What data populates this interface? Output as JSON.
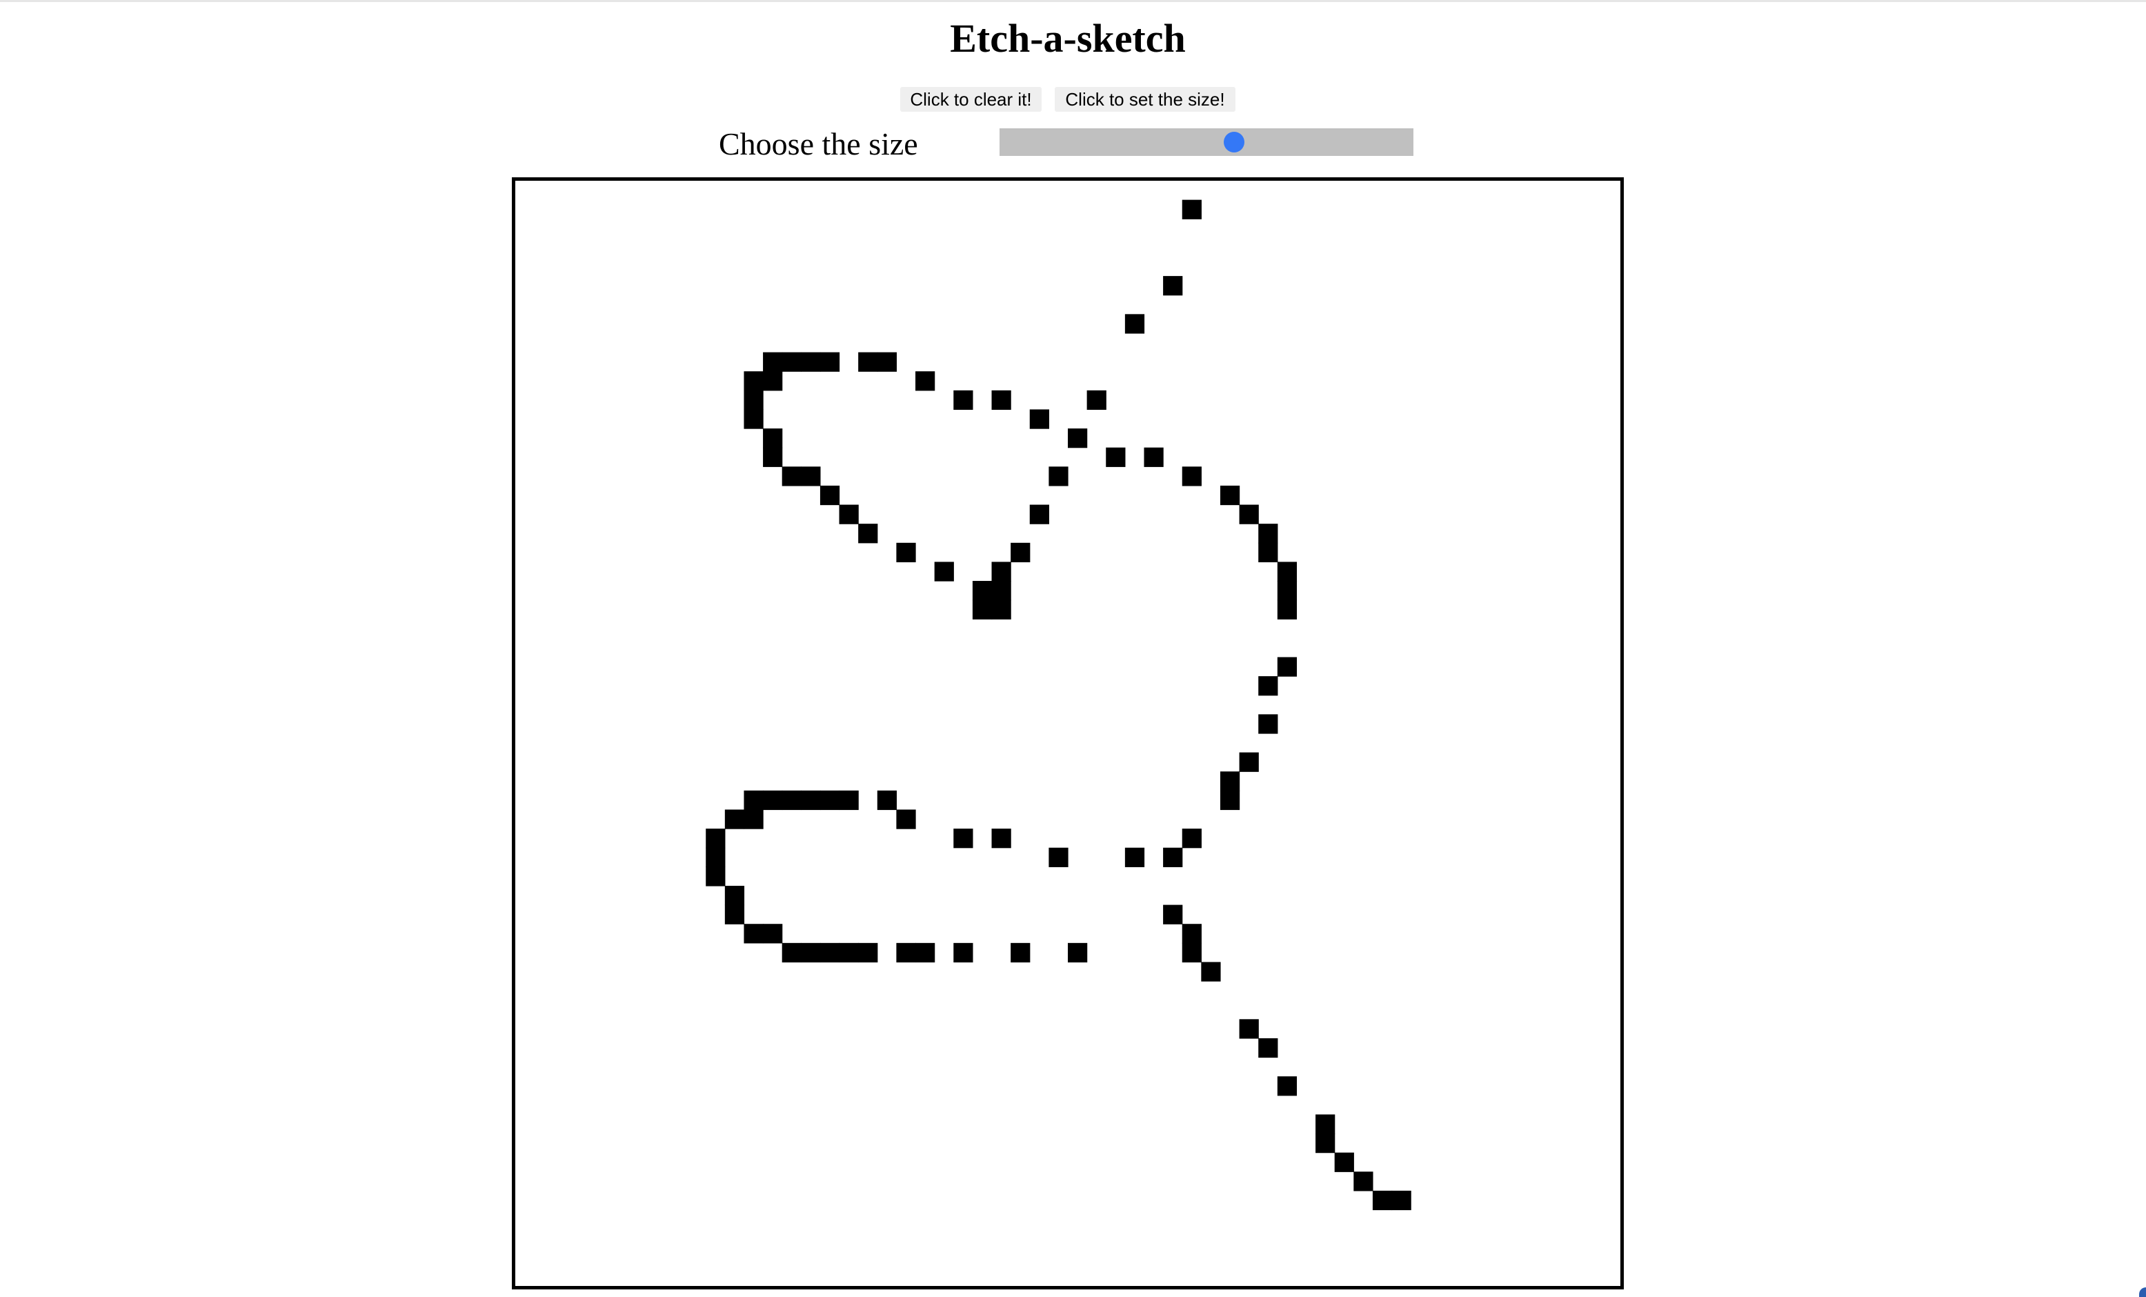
{
  "app": {
    "title": "Etch-a-sketch"
  },
  "controls": {
    "clear_label": "Click to clear it!",
    "set_size_label": "Click to set the size!",
    "size_label": "Choose the size",
    "slider": {
      "fraction": 0.57
    }
  },
  "sketch": {
    "ink_color": "#000000",
    "board_color": "#ffffff",
    "columns": 58,
    "filled_cells": [
      [
        35,
        1
      ],
      [
        34,
        5
      ],
      [
        32,
        7
      ],
      [
        13,
        9
      ],
      [
        14,
        9
      ],
      [
        15,
        9
      ],
      [
        16,
        9
      ],
      [
        18,
        9
      ],
      [
        19,
        9
      ],
      [
        12,
        10
      ],
      [
        13,
        10
      ],
      [
        21,
        10
      ],
      [
        12,
        11
      ],
      [
        23,
        11
      ],
      [
        25,
        11
      ],
      [
        30,
        11
      ],
      [
        12,
        12
      ],
      [
        27,
        12
      ],
      [
        13,
        13
      ],
      [
        29,
        13
      ],
      [
        13,
        14
      ],
      [
        31,
        14
      ],
      [
        33,
        14
      ],
      [
        14,
        15
      ],
      [
        15,
        15
      ],
      [
        28,
        15
      ],
      [
        35,
        15
      ],
      [
        16,
        16
      ],
      [
        37,
        16
      ],
      [
        17,
        17
      ],
      [
        27,
        17
      ],
      [
        38,
        17
      ],
      [
        18,
        18
      ],
      [
        39,
        18
      ],
      [
        20,
        19
      ],
      [
        26,
        19
      ],
      [
        39,
        19
      ],
      [
        22,
        20
      ],
      [
        25,
        20
      ],
      [
        40,
        20
      ],
      [
        24,
        21
      ],
      [
        25,
        21
      ],
      [
        40,
        21
      ],
      [
        24,
        22
      ],
      [
        25,
        22
      ],
      [
        40,
        22
      ],
      [
        40,
        25
      ],
      [
        39,
        26
      ],
      [
        39,
        28
      ],
      [
        38,
        30
      ],
      [
        37,
        31
      ],
      [
        12,
        32
      ],
      [
        13,
        32
      ],
      [
        14,
        32
      ],
      [
        15,
        32
      ],
      [
        16,
        32
      ],
      [
        17,
        32
      ],
      [
        19,
        32
      ],
      [
        37,
        32
      ],
      [
        11,
        33
      ],
      [
        12,
        33
      ],
      [
        20,
        33
      ],
      [
        10,
        34
      ],
      [
        23,
        34
      ],
      [
        25,
        34
      ],
      [
        35,
        34
      ],
      [
        10,
        35
      ],
      [
        28,
        35
      ],
      [
        32,
        35
      ],
      [
        34,
        35
      ],
      [
        10,
        36
      ],
      [
        11,
        37
      ],
      [
        11,
        38
      ],
      [
        34,
        38
      ],
      [
        12,
        39
      ],
      [
        13,
        39
      ],
      [
        35,
        39
      ],
      [
        14,
        40
      ],
      [
        15,
        40
      ],
      [
        16,
        40
      ],
      [
        17,
        40
      ],
      [
        18,
        40
      ],
      [
        20,
        40
      ],
      [
        21,
        40
      ],
      [
        23,
        40
      ],
      [
        26,
        40
      ],
      [
        29,
        40
      ],
      [
        35,
        40
      ],
      [
        36,
        41
      ],
      [
        38,
        44
      ],
      [
        39,
        45
      ],
      [
        40,
        47
      ],
      [
        42,
        49
      ],
      [
        42,
        50
      ],
      [
        43,
        51
      ],
      [
        44,
        52
      ],
      [
        45,
        53
      ],
      [
        46,
        53
      ]
    ]
  }
}
